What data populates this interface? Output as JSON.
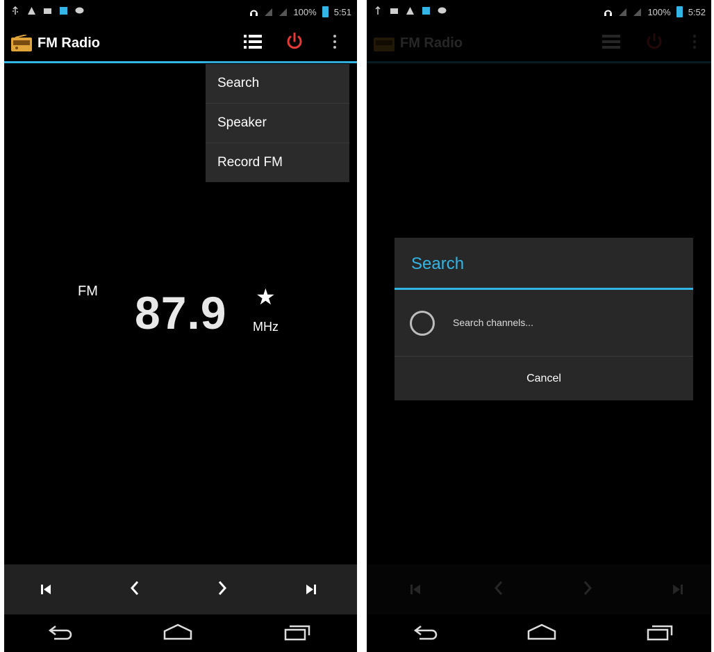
{
  "left_screen": {
    "status": {
      "battery": "100%",
      "time": "5:51"
    },
    "app_title": "FM Radio",
    "menu_items": [
      "Search",
      "Speaker",
      "Record FM"
    ],
    "band": "FM",
    "frequency": "87.9",
    "unit": "MHz",
    "favorite_icon": "star-icon",
    "controls": [
      "skip-previous-icon",
      "chevron-left-icon",
      "chevron-right-icon",
      "skip-next-icon"
    ],
    "nav": [
      "back-icon",
      "home-icon",
      "recents-icon"
    ]
  },
  "right_screen": {
    "status": {
      "battery": "100%",
      "time": "5:52"
    },
    "app_title": "FM Radio",
    "dialog": {
      "title": "Search",
      "message": "Search channels...",
      "cancel_label": "Cancel"
    }
  },
  "colors": {
    "accent": "#33b5e5",
    "power": "#e53935",
    "menu_bg": "#2b2b2b",
    "controls_bg": "#222222"
  }
}
